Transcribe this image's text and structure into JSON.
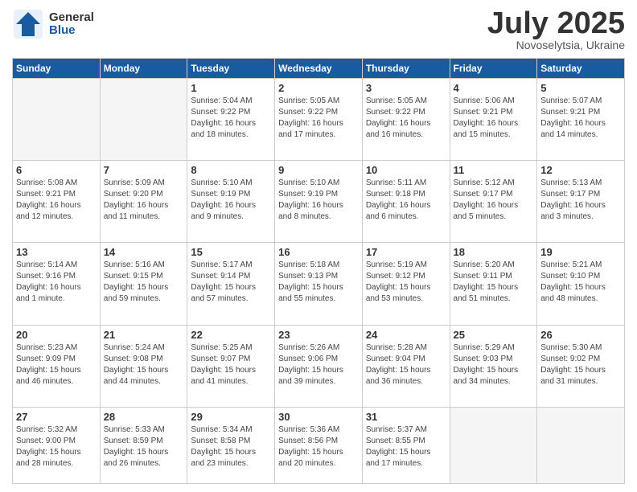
{
  "header": {
    "logo_general": "General",
    "logo_blue": "Blue",
    "month_title": "July 2025",
    "subtitle": "Novoselytsia, Ukraine"
  },
  "weekdays": [
    "Sunday",
    "Monday",
    "Tuesday",
    "Wednesday",
    "Thursday",
    "Friday",
    "Saturday"
  ],
  "weeks": [
    [
      {
        "day": "",
        "info": ""
      },
      {
        "day": "",
        "info": ""
      },
      {
        "day": "1",
        "info": "Sunrise: 5:04 AM\nSunset: 9:22 PM\nDaylight: 16 hours and 18 minutes."
      },
      {
        "day": "2",
        "info": "Sunrise: 5:05 AM\nSunset: 9:22 PM\nDaylight: 16 hours and 17 minutes."
      },
      {
        "day": "3",
        "info": "Sunrise: 5:05 AM\nSunset: 9:22 PM\nDaylight: 16 hours and 16 minutes."
      },
      {
        "day": "4",
        "info": "Sunrise: 5:06 AM\nSunset: 9:21 PM\nDaylight: 16 hours and 15 minutes."
      },
      {
        "day": "5",
        "info": "Sunrise: 5:07 AM\nSunset: 9:21 PM\nDaylight: 16 hours and 14 minutes."
      }
    ],
    [
      {
        "day": "6",
        "info": "Sunrise: 5:08 AM\nSunset: 9:21 PM\nDaylight: 16 hours and 12 minutes."
      },
      {
        "day": "7",
        "info": "Sunrise: 5:09 AM\nSunset: 9:20 PM\nDaylight: 16 hours and 11 minutes."
      },
      {
        "day": "8",
        "info": "Sunrise: 5:10 AM\nSunset: 9:19 PM\nDaylight: 16 hours and 9 minutes."
      },
      {
        "day": "9",
        "info": "Sunrise: 5:10 AM\nSunset: 9:19 PM\nDaylight: 16 hours and 8 minutes."
      },
      {
        "day": "10",
        "info": "Sunrise: 5:11 AM\nSunset: 9:18 PM\nDaylight: 16 hours and 6 minutes."
      },
      {
        "day": "11",
        "info": "Sunrise: 5:12 AM\nSunset: 9:17 PM\nDaylight: 16 hours and 5 minutes."
      },
      {
        "day": "12",
        "info": "Sunrise: 5:13 AM\nSunset: 9:17 PM\nDaylight: 16 hours and 3 minutes."
      }
    ],
    [
      {
        "day": "13",
        "info": "Sunrise: 5:14 AM\nSunset: 9:16 PM\nDaylight: 16 hours and 1 minute."
      },
      {
        "day": "14",
        "info": "Sunrise: 5:16 AM\nSunset: 9:15 PM\nDaylight: 15 hours and 59 minutes."
      },
      {
        "day": "15",
        "info": "Sunrise: 5:17 AM\nSunset: 9:14 PM\nDaylight: 15 hours and 57 minutes."
      },
      {
        "day": "16",
        "info": "Sunrise: 5:18 AM\nSunset: 9:13 PM\nDaylight: 15 hours and 55 minutes."
      },
      {
        "day": "17",
        "info": "Sunrise: 5:19 AM\nSunset: 9:12 PM\nDaylight: 15 hours and 53 minutes."
      },
      {
        "day": "18",
        "info": "Sunrise: 5:20 AM\nSunset: 9:11 PM\nDaylight: 15 hours and 51 minutes."
      },
      {
        "day": "19",
        "info": "Sunrise: 5:21 AM\nSunset: 9:10 PM\nDaylight: 15 hours and 48 minutes."
      }
    ],
    [
      {
        "day": "20",
        "info": "Sunrise: 5:23 AM\nSunset: 9:09 PM\nDaylight: 15 hours and 46 minutes."
      },
      {
        "day": "21",
        "info": "Sunrise: 5:24 AM\nSunset: 9:08 PM\nDaylight: 15 hours and 44 minutes."
      },
      {
        "day": "22",
        "info": "Sunrise: 5:25 AM\nSunset: 9:07 PM\nDaylight: 15 hours and 41 minutes."
      },
      {
        "day": "23",
        "info": "Sunrise: 5:26 AM\nSunset: 9:06 PM\nDaylight: 15 hours and 39 minutes."
      },
      {
        "day": "24",
        "info": "Sunrise: 5:28 AM\nSunset: 9:04 PM\nDaylight: 15 hours and 36 minutes."
      },
      {
        "day": "25",
        "info": "Sunrise: 5:29 AM\nSunset: 9:03 PM\nDaylight: 15 hours and 34 minutes."
      },
      {
        "day": "26",
        "info": "Sunrise: 5:30 AM\nSunset: 9:02 PM\nDaylight: 15 hours and 31 minutes."
      }
    ],
    [
      {
        "day": "27",
        "info": "Sunrise: 5:32 AM\nSunset: 9:00 PM\nDaylight: 15 hours and 28 minutes."
      },
      {
        "day": "28",
        "info": "Sunrise: 5:33 AM\nSunset: 8:59 PM\nDaylight: 15 hours and 26 minutes."
      },
      {
        "day": "29",
        "info": "Sunrise: 5:34 AM\nSunset: 8:58 PM\nDaylight: 15 hours and 23 minutes."
      },
      {
        "day": "30",
        "info": "Sunrise: 5:36 AM\nSunset: 8:56 PM\nDaylight: 15 hours and 20 minutes."
      },
      {
        "day": "31",
        "info": "Sunrise: 5:37 AM\nSunset: 8:55 PM\nDaylight: 15 hours and 17 minutes."
      },
      {
        "day": "",
        "info": ""
      },
      {
        "day": "",
        "info": ""
      }
    ]
  ]
}
